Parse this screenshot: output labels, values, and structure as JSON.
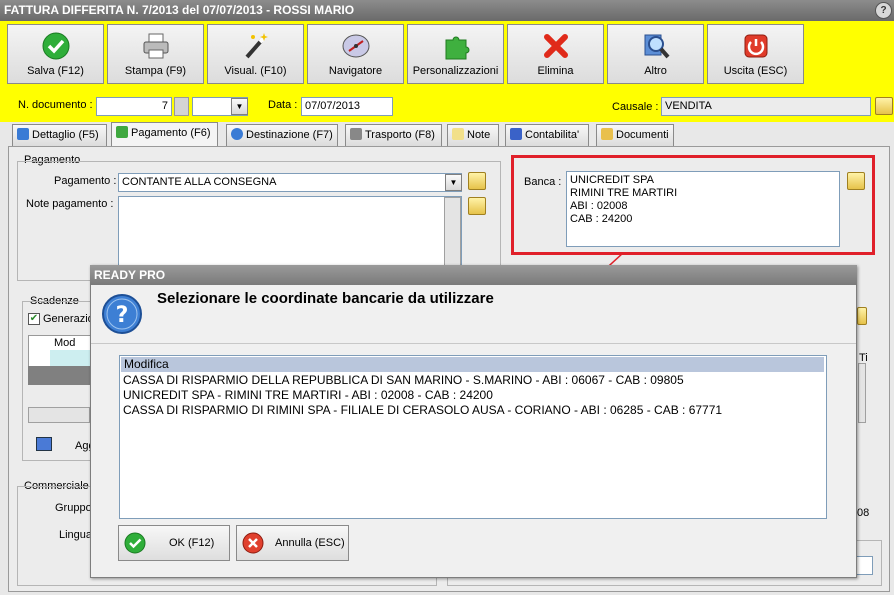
{
  "window": {
    "title": "FATTURA DIFFERITA N. 7/2013 del 07/07/2013 - ROSSI MARIO"
  },
  "toolbar": {
    "buttons": [
      {
        "label": "Salva (F12)",
        "icon": "save-check-icon"
      },
      {
        "label": "Stampa (F9)",
        "icon": "printer-icon"
      },
      {
        "label": "Visual. (F10)",
        "icon": "magic-wand-icon"
      },
      {
        "label": "Navigatore",
        "icon": "compass-icon"
      },
      {
        "label": "Personalizzazioni",
        "icon": "puzzle-icon"
      },
      {
        "label": "Elimina",
        "icon": "delete-x-icon"
      },
      {
        "label": "Altro",
        "icon": "magnifier-icon"
      },
      {
        "label": "Uscita (ESC)",
        "icon": "power-icon"
      }
    ]
  },
  "header": {
    "doc_label": "N. documento :",
    "doc_value": "7",
    "data_label": "Data :",
    "data_value": "07/07/2013",
    "causale_label": "Causale :",
    "causale_value": "VENDITA"
  },
  "tabs": [
    {
      "label": "Dettaglio (F5)"
    },
    {
      "label": "Pagamento (F6)"
    },
    {
      "label": "Destinazione (F7)"
    },
    {
      "label": "Trasporto (F8)"
    },
    {
      "label": "Note"
    },
    {
      "label": "Contabilita'"
    },
    {
      "label": "Documenti"
    }
  ],
  "pagamento": {
    "group_label": "Pagamento",
    "pagamento_label": "Pagamento :",
    "pagamento_value": "CONTANTE ALLA CONSEGNA",
    "note_label": "Note pagamento :",
    "banca_label": "Banca :",
    "banca_lines": [
      "UNICREDIT SPA",
      "RIMINI TRE MARTIRI",
      "ABI : 02008",
      "CAB : 24200"
    ]
  },
  "scadenze": {
    "group_label": "Scadenze",
    "gen_label": "Generazio",
    "col_mod": "Mod",
    "add_label": "Agg",
    "right_text_1": "Ti",
    "right_text_2": "08"
  },
  "commerciale": {
    "group_label": "Commerciale",
    "gruppo_label": "Gruppo",
    "lingua_label": "Lingua"
  },
  "dialog": {
    "title": "READY PRO",
    "message": "Selezionare le coordinate bancarie da utilizzare",
    "items": [
      "Modifica",
      "CASSA DI RISPARMIO DELLA REPUBBLICA DI SAN MARINO - S.MARINO - ABI : 06067 - CAB : 09805",
      "UNICREDIT SPA - RIMINI TRE MARTIRI - ABI : 02008 - CAB : 24200",
      "CASSA DI RISPARMIO DI RIMINI SPA - FILIALE DI CERASOLO AUSA - CORIANO - ABI : 06285 - CAB : 67771"
    ],
    "ok_label": "OK (F12)",
    "cancel_label": "Annulla (ESC)"
  },
  "colors": {
    "toolbar": "#ffff00",
    "highlight_frame": "#e0202a",
    "arrow": "#e0202a"
  }
}
